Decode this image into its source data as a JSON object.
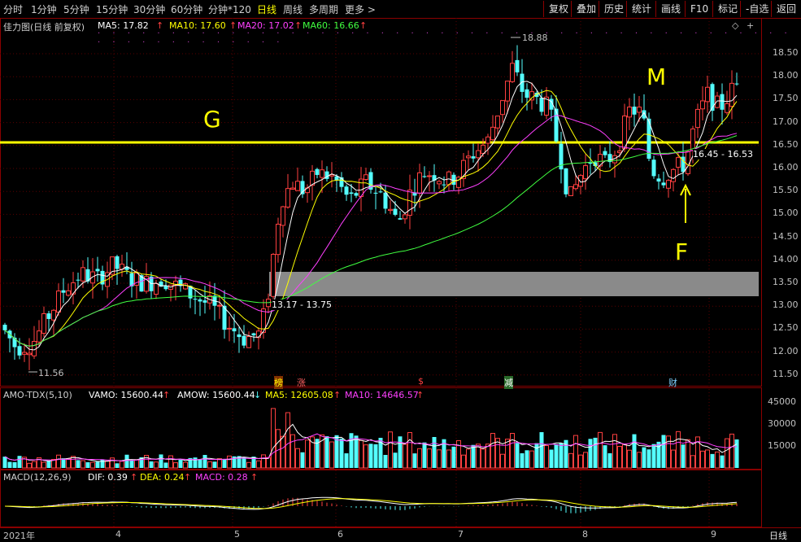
{
  "toolbar": {
    "periods": [
      "分时",
      "1分钟",
      "5分钟",
      "15分钟",
      "30分钟",
      "60分钟",
      "分钟*120",
      "日线",
      "周线",
      "多周期",
      "更多 >"
    ],
    "active_period": "日线",
    "right_buttons": [
      "复权",
      "叠加",
      "历史",
      "统计",
      "画线",
      "F10",
      "标记",
      "-自选",
      "返回"
    ]
  },
  "price_panel": {
    "title": "佳力图(日线 前复权)",
    "ma5": "MA5: 17.82",
    "ma10": "MA10: 17.60",
    "ma20": "MA20: 17.02",
    "ma60": "MA60: 16.66",
    "y_ticks": [
      "18.50",
      "18.00",
      "17.50",
      "17.00",
      "16.50",
      "16.00",
      "15.50",
      "15.00",
      "14.50",
      "14.00",
      "13.50",
      "13.00",
      "12.50",
      "12.00",
      "11.50"
    ],
    "high_label": "18.88",
    "low_label": "11.56",
    "range_label_1": "13.17 - 13.75",
    "range_label_2": "16.45 - 16.53",
    "annotation_g": "G",
    "annotation_m": "M",
    "annotation_f": "F",
    "event_marks": [
      "榜",
      "涨",
      "$",
      "减",
      "财"
    ]
  },
  "volume_panel": {
    "title": "AMO-TDX(5,10)",
    "vamo": "VAMO: 15600.44",
    "amow": "AMOW: 15600.44",
    "ma5": "MA5: 12605.08",
    "ma10": "MA10: 14646.57",
    "y_ticks": [
      "45000",
      "30000",
      "15000"
    ]
  },
  "macd_panel": {
    "title": "MACD(12,26,9)",
    "dif": "DIF: 0.39",
    "dea": "DEA: 0.24",
    "macd": "MACD: 0.28"
  },
  "x_axis": {
    "labels": [
      "2021年",
      "4",
      "5",
      "6",
      "7",
      "8",
      "9"
    ],
    "period_label": "日线"
  },
  "colors": {
    "up": "#ff4040",
    "down": "#54ffff",
    "ma5": "#ffffff",
    "ma10": "#ffff00",
    "ma20": "#ff40ff",
    "ma60": "#40ff40",
    "annotation": "#ffff00"
  }
}
